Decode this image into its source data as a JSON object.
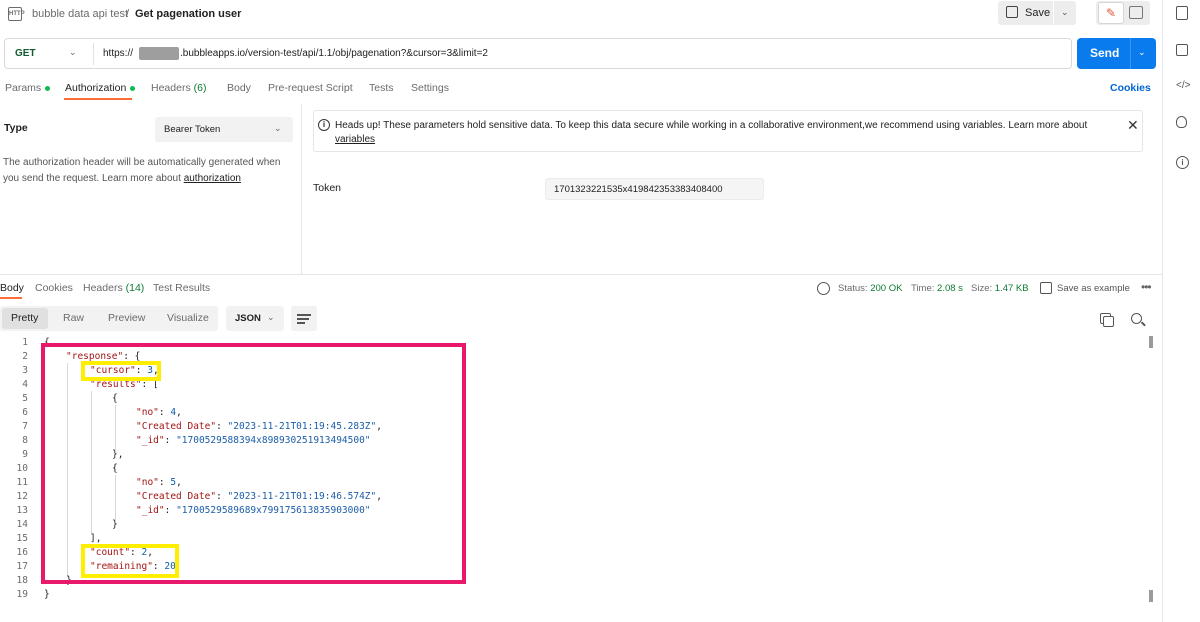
{
  "header": {
    "icon": "http-icon",
    "breadcrumb_parent": "bubble data api test",
    "breadcrumb_separator": "/",
    "breadcrumb_current": "Get pagenation user",
    "save_label": "Save"
  },
  "request": {
    "method": "GET",
    "url_prefix": "https://",
    "url_suffix": ".bubbleapps.io/version-test/api/1.1/obj/pagenation?&cursor=3&limit=2",
    "send_label": "Send"
  },
  "request_tabs": {
    "params": "Params",
    "authorization": "Authorization",
    "headers": "Headers",
    "headers_count": "(6)",
    "body": "Body",
    "prerequest": "Pre-request Script",
    "tests": "Tests",
    "settings": "Settings",
    "cookies": "Cookies"
  },
  "auth": {
    "type_label": "Type",
    "type_value": "Bearer Token",
    "help_text": "The authorization header will be automatically generated when you send the request. Learn more about ",
    "help_link": "authorization",
    "notice_text": "Heads up! These parameters hold sensitive data. To keep this data secure while working in a collaborative environment,we recommend using variables. Learn more about ",
    "notice_link": "variables",
    "token_label": "Token",
    "token_value": "1701323221535x419842353383408400"
  },
  "response_tabs": {
    "body": "Body",
    "cookies": "Cookies",
    "headers": "Headers",
    "headers_count": "(14)",
    "test_results": "Test Results"
  },
  "response_meta": {
    "status_label": "Status:",
    "status_value": "200 OK",
    "time_label": "Time:",
    "time_value": "2.08 s",
    "size_label": "Size:",
    "size_value": "1.47 KB",
    "save_example": "Save as example"
  },
  "view": {
    "pretty": "Pretty",
    "raw": "Raw",
    "preview": "Preview",
    "visualize": "Visualize",
    "format": "JSON"
  },
  "code": {
    "line_numbers": [
      "1",
      "2",
      "3",
      "4",
      "5",
      "6",
      "7",
      "8",
      "9",
      "10",
      "11",
      "12",
      "13",
      "14",
      "15",
      "16",
      "17",
      "18",
      "19"
    ],
    "keys": {
      "response": "\"response\"",
      "cursor": "\"cursor\"",
      "results": "\"results\"",
      "no": "\"no\"",
      "created_date": "\"Created Date\"",
      "id": "\"_id\"",
      "count": "\"count\"",
      "remaining": "\"remaining\""
    },
    "values": {
      "cursor": "3",
      "item1_no": "4",
      "item1_date": "\"2023-11-21T01:19:45.283Z\"",
      "item1_id": "\"1700529588394x898930251913494500\"",
      "item2_no": "5",
      "item2_date": "\"2023-11-21T01:19:46.574Z\"",
      "item2_id": "\"1700529589689x799175613835903000\"",
      "count": "2",
      "remaining": "20"
    }
  },
  "colors": {
    "accent": "#ff6c37",
    "send": "#097bed",
    "annotation_pink": "#e8196b",
    "annotation_yellow": "#ffee00",
    "status_green": "#0e7a33"
  }
}
